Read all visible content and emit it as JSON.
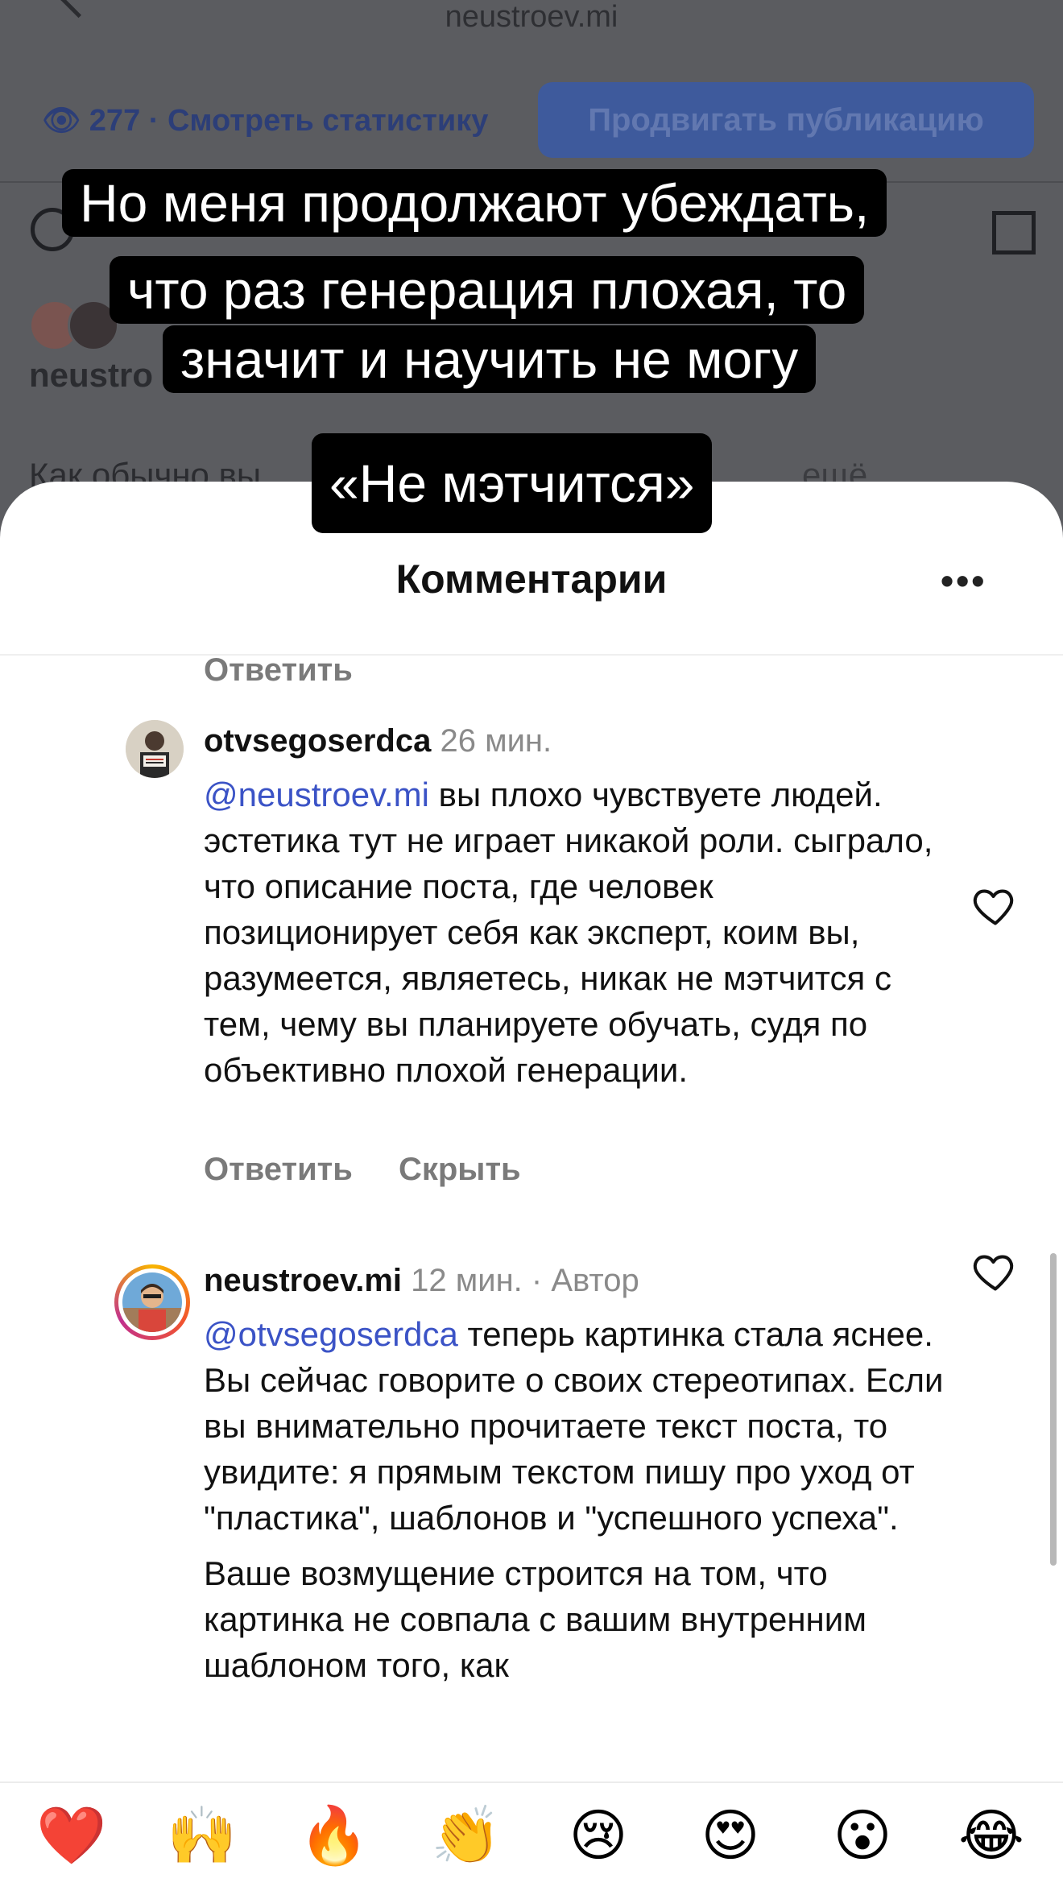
{
  "background_post": {
    "username_top": "neustroev.mi",
    "stats": "👁 277 · Смотреть статистику",
    "promote_button": "Продвигать публикацию",
    "username": "neustro",
    "caption": "Как обычно вы",
    "caption_more": "ещё"
  },
  "overlay_captions": {
    "line1": "Но меня продолжают убеждать,",
    "line2": "что раз генерация плохая, то",
    "line3": "значит и научить не могу",
    "line4": "«Не мэтчится»"
  },
  "sheet": {
    "title": "Комментарии",
    "more_label": "•••",
    "prev_reply": "Ответить"
  },
  "comments": [
    {
      "username": "otvsegoserdca",
      "time": "26 мин.",
      "mention": "@neustroev.mi",
      "text": "вы плохо чувствуете людей. эстетика тут не играет никакой роли. сыграло, что описание поста, где человек позиционирует себя как эксперт, коим вы, разумеется, являетесь, никак не мэтчится с тем, чему вы планируете обучать, судя по объективно плохой генерации.",
      "reply": "Ответить",
      "hide": "Скрыть"
    },
    {
      "username": "neustroev.mi",
      "time": "12 мин. · Автор",
      "mention": "@otvsegoserdca",
      "text": "теперь картинка стала яснее. Вы сейчас говорите о своих стереотипах. Если вы внимательно прочитаете текст поста, то увидите: я прямым текстом пишу про уход от \"пластика\", шаблонов и \"успешного успеха\".",
      "text2": "Ваше возмущение строится на том, что картинка не совпала с вашим внутренним шаблоном того, как"
    }
  ],
  "emoji_bar": [
    "❤️",
    "🙌",
    "🔥",
    "👏",
    "😢",
    "😍",
    "😮",
    "😂"
  ]
}
